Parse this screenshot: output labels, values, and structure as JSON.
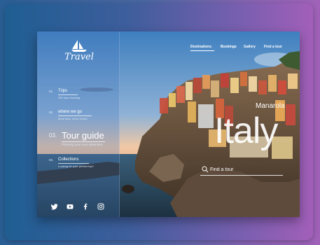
{
  "brand": {
    "logo_text": "Travel",
    "logo_icon": "sailboat-icon"
  },
  "nav": {
    "items": [
      {
        "label": "Destinations",
        "active": true
      },
      {
        "label": "Bookings"
      },
      {
        "label": "Gallery"
      },
      {
        "label": "Find a tour"
      }
    ]
  },
  "menu": {
    "items": [
      {
        "num": "01.",
        "title": "Trips",
        "subtitle": "350 trips showing"
      },
      {
        "num": "02.",
        "title": "where we go",
        "subtitle": "More trips, more choice"
      },
      {
        "num": "03.",
        "title": "Tour guide",
        "subtitle": "Planning your next adventure",
        "active": true
      },
      {
        "num": "04.",
        "title": "Collections",
        "subtitle": "Looking for your perfect trip?"
      }
    ]
  },
  "hero": {
    "place": "Manarola",
    "country": "Italy"
  },
  "search": {
    "placeholder": "Find a tour"
  },
  "social": [
    "twitter-icon",
    "youtube-icon",
    "facebook-icon",
    "instagram-icon"
  ],
  "colors": {
    "accent_left": "#2a5f95",
    "accent_right": "#a062b8"
  }
}
